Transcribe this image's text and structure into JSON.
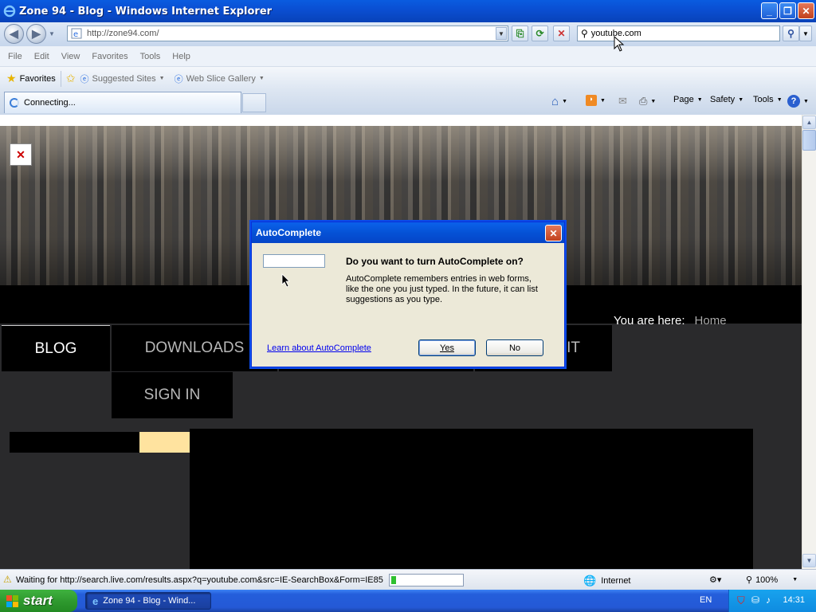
{
  "window": {
    "title": "Zone 94 - Blog - Windows Internet Explorer"
  },
  "address": {
    "url": "http://zone94.com/"
  },
  "search": {
    "value": "youtube.com"
  },
  "menu": [
    "File",
    "Edit",
    "View",
    "Favorites",
    "Tools",
    "Help"
  ],
  "favorites_bar": {
    "favorites": "Favorites",
    "suggested": "Suggested Sites",
    "webslice": "Web Slice Gallery"
  },
  "tab": {
    "label": "Connecting..."
  },
  "command_bar": {
    "page": "Page",
    "safety": "Safety",
    "tools": "Tools"
  },
  "site": {
    "nav": {
      "blog": "BLOG",
      "downloads": "DOWNLOADS",
      "partial": "IT",
      "signin": "SIGN IN"
    },
    "breadcrumb": {
      "label": "You are here:",
      "home": "Home"
    }
  },
  "dialog": {
    "title": "AutoComplete",
    "question": "Do you want to turn AutoComplete on?",
    "description_1": "AutoComplete remembers entries in web forms,",
    "description_2": "like the one you just typed. In the future, it can list",
    "description_3": "suggestions as you type.",
    "link": "Learn about AutoComplete",
    "yes": "Yes",
    "no": "No"
  },
  "status": {
    "text": "Waiting for http://search.live.com/results.aspx?q=youtube.com&src=IE-SearchBox&Form=IE85",
    "progress": 0.07,
    "zone": "Internet",
    "zoom": "100%"
  },
  "taskbar": {
    "start": "start",
    "task": "Zone 94 - Blog - Wind...",
    "lang": "EN",
    "time": "14:31"
  },
  "colors": {
    "titlebar": "#0a5ce0",
    "accent_yellow": "#ffe39f",
    "start_green": "#3fb23f"
  }
}
